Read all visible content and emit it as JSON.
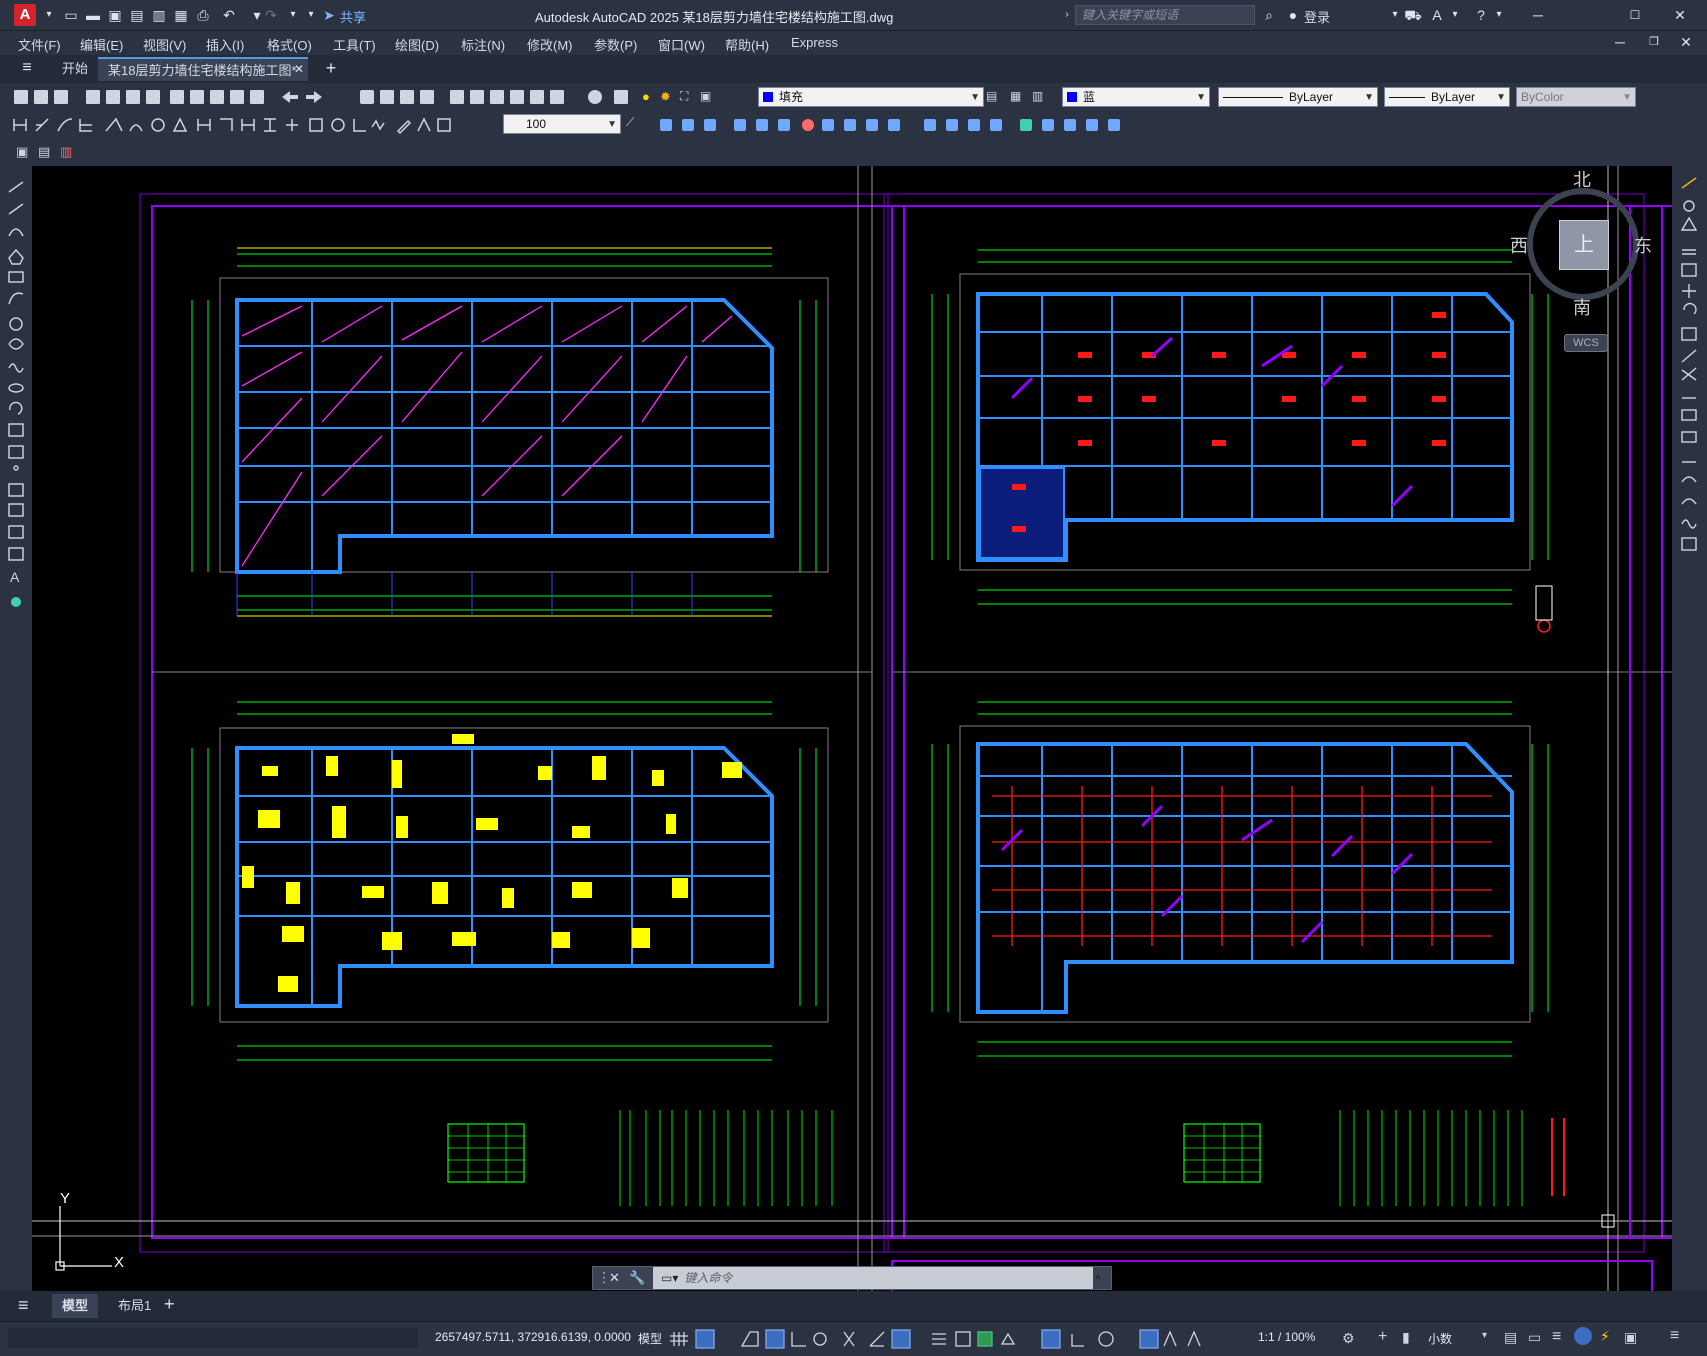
{
  "app": {
    "logo_letter": "A",
    "title": "Autodesk AutoCAD 2025    某18层剪力墙住宅楼结构施工图.dwg",
    "share_label": "共享",
    "search_placeholder": "键入关键字或短语",
    "login_label": "登录"
  },
  "menu": [
    "文件(F)",
    "编辑(E)",
    "视图(V)",
    "插入(I)",
    "格式(O)",
    "工具(T)",
    "绘图(D)",
    "标注(N)",
    "修改(M)",
    "参数(P)",
    "窗口(W)",
    "帮助(H)",
    "Express"
  ],
  "tabs": {
    "start": "开始",
    "active_doc": "某18层剪力墙住宅楼结构施工图*"
  },
  "properties": {
    "fill_layer": "填充",
    "color": "蓝",
    "linetype": "ByLayer",
    "lineweight": "ByLayer",
    "plotstyle": "ByColor",
    "scale_value": "100",
    "colors": {
      "blue_swatch": "#0000ff"
    }
  },
  "viewcube": {
    "north": "北",
    "south": "南",
    "east": "东",
    "west": "西",
    "top": "上",
    "wcs": "WCS"
  },
  "ucs": {
    "x": "X",
    "y": "Y"
  },
  "command": {
    "placeholder": "键入命令"
  },
  "layout_tabs": {
    "model": "模型",
    "layout1": "布局1"
  },
  "status": {
    "coordinates": "2657497.5711, 372916.6139, 0.0000",
    "model": "模型",
    "annotation_scale": "1:1 / 100%",
    "units": "小数"
  }
}
